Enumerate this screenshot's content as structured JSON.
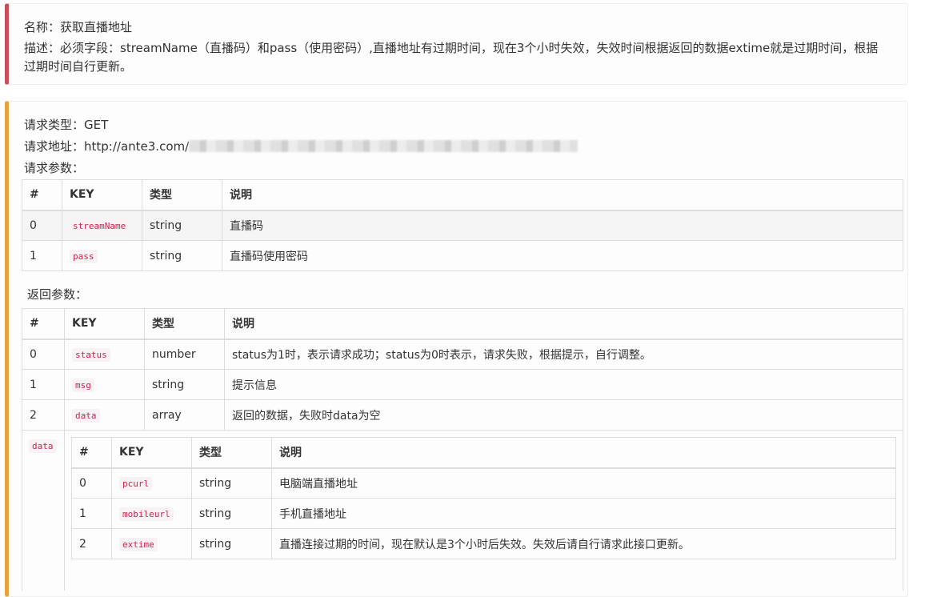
{
  "info": {
    "name_line": "名称：获取直播地址",
    "desc_line": "描述：必须字段：streamName（直播码）和pass（使用密码）,直播地址有过期时间，现在3个小时失效，失效时间根据返回的数据extime就是过期时间，根据过期时间自行更新。"
  },
  "request": {
    "type_line": "请求类型：GET",
    "url_prefix": "请求地址：http://ante3.com/",
    "params_label": "请求参数：",
    "headers": [
      "#",
      "KEY",
      "类型",
      "说明"
    ],
    "rows": [
      {
        "idx": "0",
        "key": "streamName",
        "type": "string",
        "desc": "直播码"
      },
      {
        "idx": "1",
        "key": "pass",
        "type": "string",
        "desc": "直播码使用密码"
      }
    ]
  },
  "response": {
    "label": "返回参数：",
    "headers": [
      "#",
      "KEY",
      "类型",
      "说明"
    ],
    "rows": [
      {
        "idx": "0",
        "key": "status",
        "type": "number",
        "desc": "status为1时，表示请求成功；status为0时表示，请求失败，根据提示，自行调整。"
      },
      {
        "idx": "1",
        "key": "msg",
        "type": "string",
        "desc": "提示信息"
      },
      {
        "idx": "2",
        "key": "data",
        "type": "array",
        "desc": "返回的数据，失败时data为空"
      }
    ],
    "data_key": "data",
    "data_headers": [
      "#",
      "KEY",
      "类型",
      "说明"
    ],
    "data_rows": [
      {
        "idx": "0",
        "key": "pcurl",
        "type": "string",
        "desc": "电脑端直播地址"
      },
      {
        "idx": "1",
        "key": "mobileurl",
        "type": "string",
        "desc": "手机直播地址"
      },
      {
        "idx": "2",
        "key": "extime",
        "type": "string",
        "desc": "直播连接过期的时间，现在默认是3个小时后失效。失效后请自行请求此接口更新。"
      }
    ]
  }
}
